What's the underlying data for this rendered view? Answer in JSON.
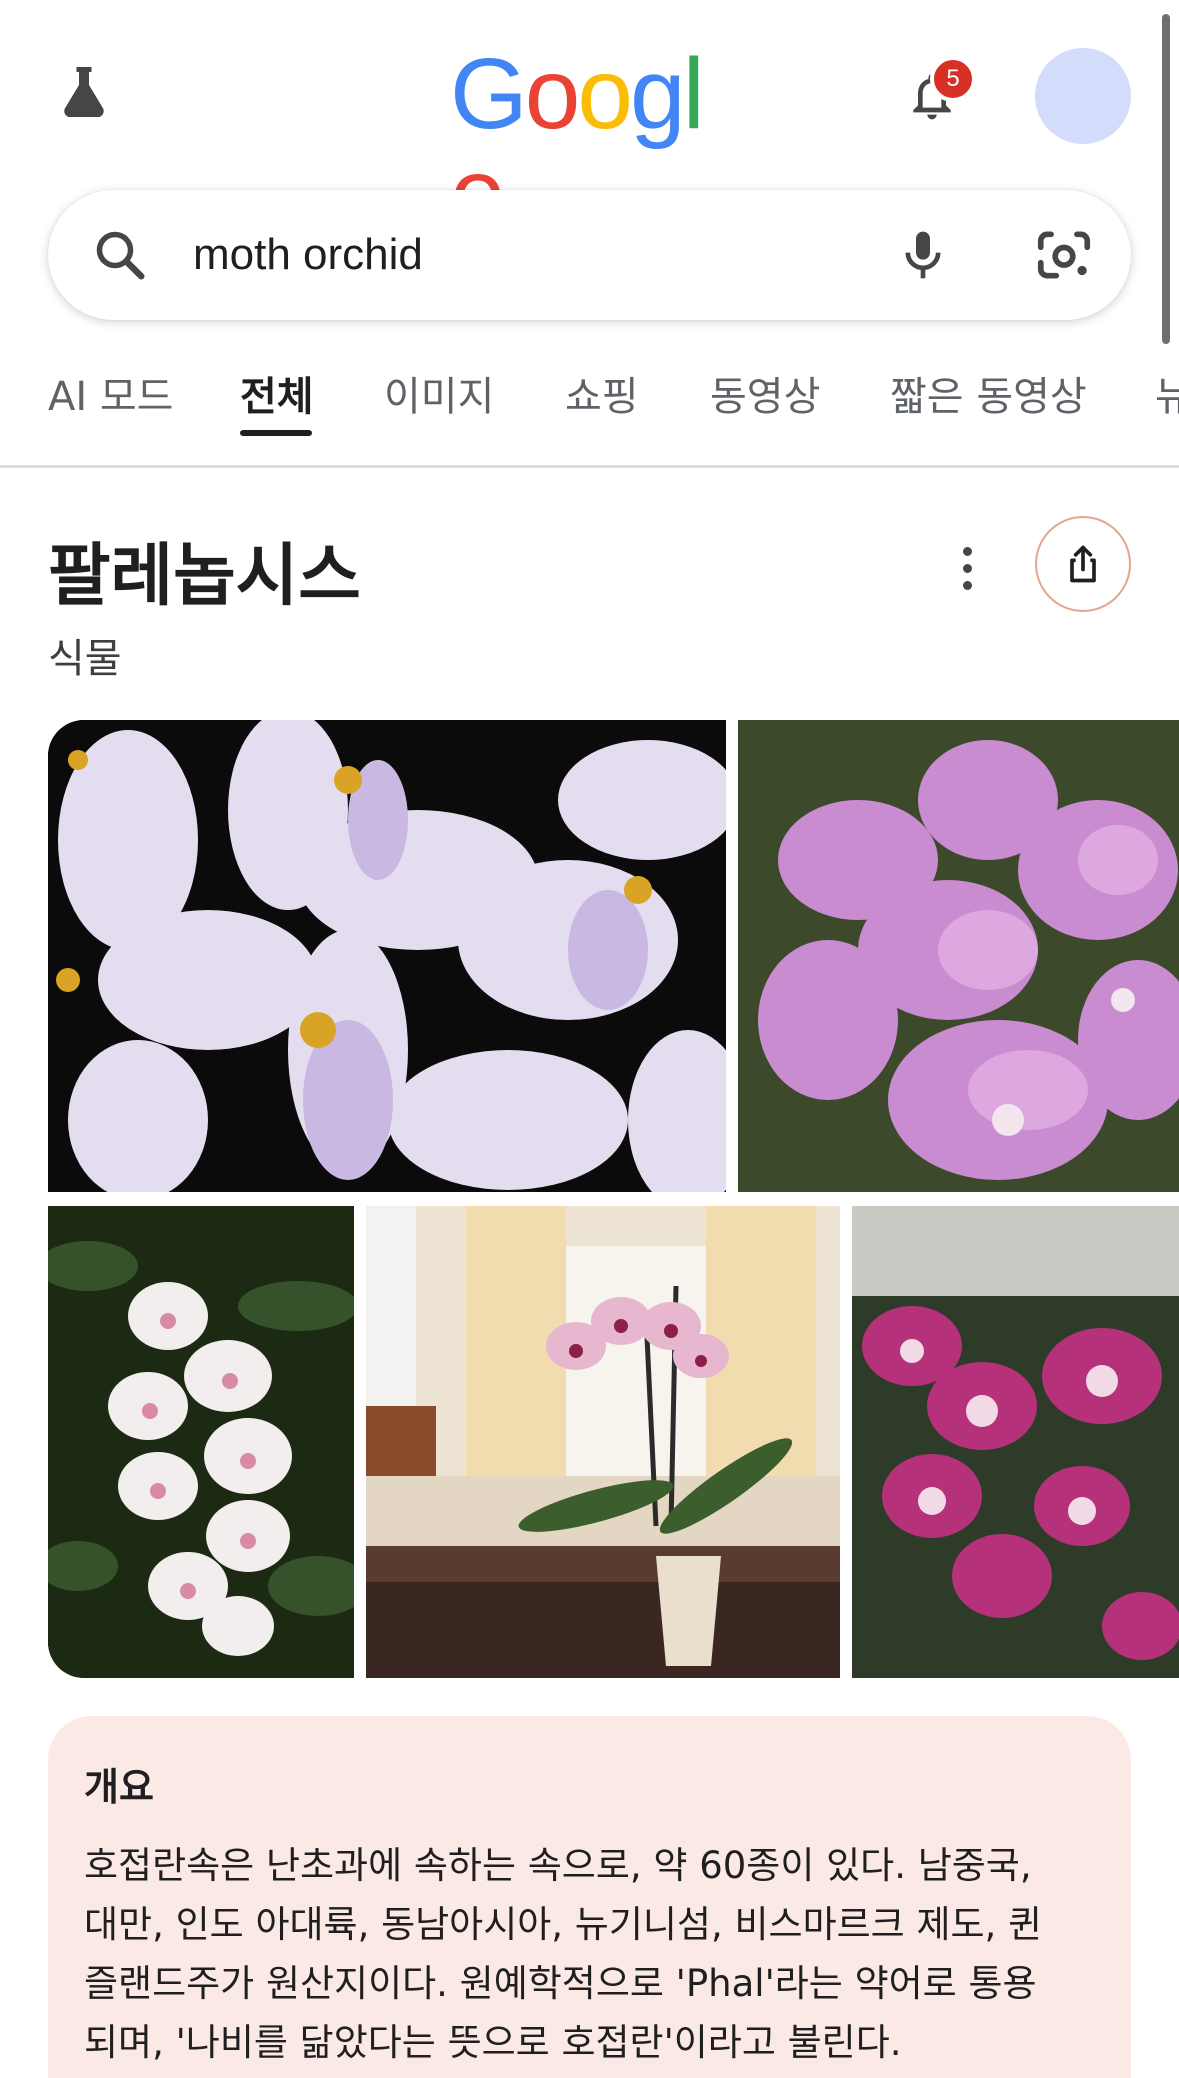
{
  "header": {
    "logo_letters": [
      {
        "char": "G",
        "color": "#4285F4"
      },
      {
        "char": "o",
        "color": "#EA4335"
      },
      {
        "char": "o",
        "color": "#FBBC05"
      },
      {
        "char": "g",
        "color": "#4285F4"
      },
      {
        "char": "l",
        "color": "#34A853"
      },
      {
        "char": "e",
        "color": "#EA4335"
      }
    ],
    "labs_icon": "flask-icon",
    "notification_icon": "bell-icon",
    "notification_count": "5",
    "avatar_color": "#d3dcfb"
  },
  "search": {
    "query": "moth orchid",
    "search_icon": "search-icon",
    "voice_icon": "mic-icon",
    "lens_icon": "camera-lens-icon"
  },
  "tabs": [
    {
      "label": "AI 모드",
      "active": false
    },
    {
      "label": "전체",
      "active": true
    },
    {
      "label": "이미지",
      "active": false
    },
    {
      "label": "쇼핑",
      "active": false
    },
    {
      "label": "동영상",
      "active": false
    },
    {
      "label": "짧은 동영상",
      "active": false
    },
    {
      "label": "뉴",
      "active": false
    }
  ],
  "knowledge_panel": {
    "title": "팔레놉시스",
    "subtitle": "식물",
    "more_icon": "more-vert-icon",
    "share_icon": "share-icon",
    "images": [
      {
        "subject": "pale lavender orchids with yellow spotted lips on black background"
      },
      {
        "subject": "pink phalaenopsis orchids in greenhouse"
      },
      {
        "subject": "white orchids with pink centers among green leaves"
      },
      {
        "subject": "potted pink orchid on table by window"
      },
      {
        "subject": "magenta spotted orchids in greenhouse"
      }
    ],
    "overview": {
      "heading": "개요",
      "lines": [
        "호접란속은 난초과에 속하는 속으로, 약 60종이 있다. 남중국,",
        "대만, 인도 아대륙, 동남아시아, 뉴기니섬, 비스마르크 제도, 퀸",
        "즐랜드주가 원산지이다. 원예학적으로 'Phal'라는 약어로 통용",
        "되며, '나비를 닮았다는 뜻으로 호접란'이라고 불린다."
      ]
    }
  }
}
